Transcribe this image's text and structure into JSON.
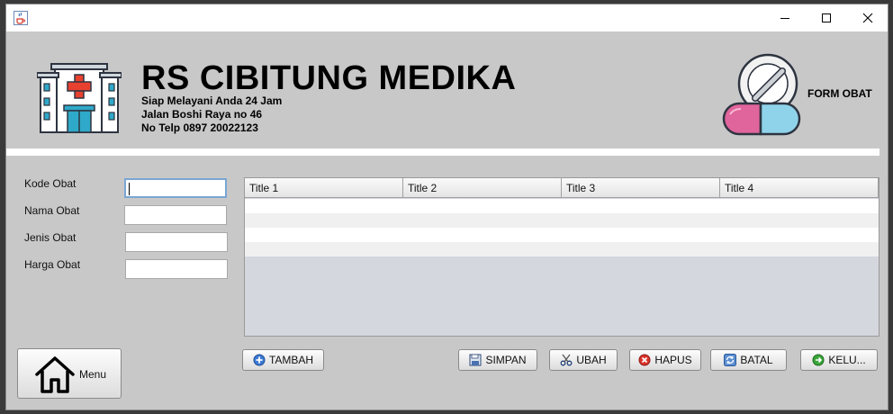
{
  "window": {
    "icon": "java-cup-icon",
    "controls": [
      "minimize-icon",
      "maximize-icon",
      "close-icon"
    ]
  },
  "header": {
    "logo": "hospital-building-icon",
    "title": "RS CIBITUNG MEDIKA",
    "tagline": "Siap Melayani Anda 24 Jam",
    "address": "Jalan Boshi Raya no 46",
    "phone": "No Telp 0897 20022123",
    "side_image": "medicine-capsule-icon",
    "form_title": "FORM OBAT"
  },
  "form": {
    "kode_label": "Kode Obat",
    "kode_value": "",
    "nama_label": "Nama Obat",
    "nama_value": "",
    "jenis_label": "Jenis Obat",
    "jenis_value": "",
    "harga_label": "Harga Obat",
    "harga_value": ""
  },
  "table": {
    "columns": [
      "Title 1",
      "Title 2",
      "Title 3",
      "Title 4"
    ],
    "rows": [
      [
        "",
        "",
        "",
        ""
      ],
      [
        "",
        "",
        "",
        ""
      ],
      [
        "",
        "",
        "",
        ""
      ],
      [
        "",
        "",
        "",
        ""
      ]
    ]
  },
  "buttons": {
    "menu": "Menu",
    "tambah": "TAMBAH",
    "simpan": "SIMPAN",
    "ubah": "UBAH",
    "hapus": "HAPUS",
    "batal": "BATAL",
    "keluar": "KELU..."
  },
  "colors": {
    "window_bg": "#c8c8c8",
    "table_empty": "#d4d7dd",
    "hapus_red": "#d9342b",
    "keluar_green": "#3aa53a",
    "tambah_blue": "#3d7bd6"
  }
}
